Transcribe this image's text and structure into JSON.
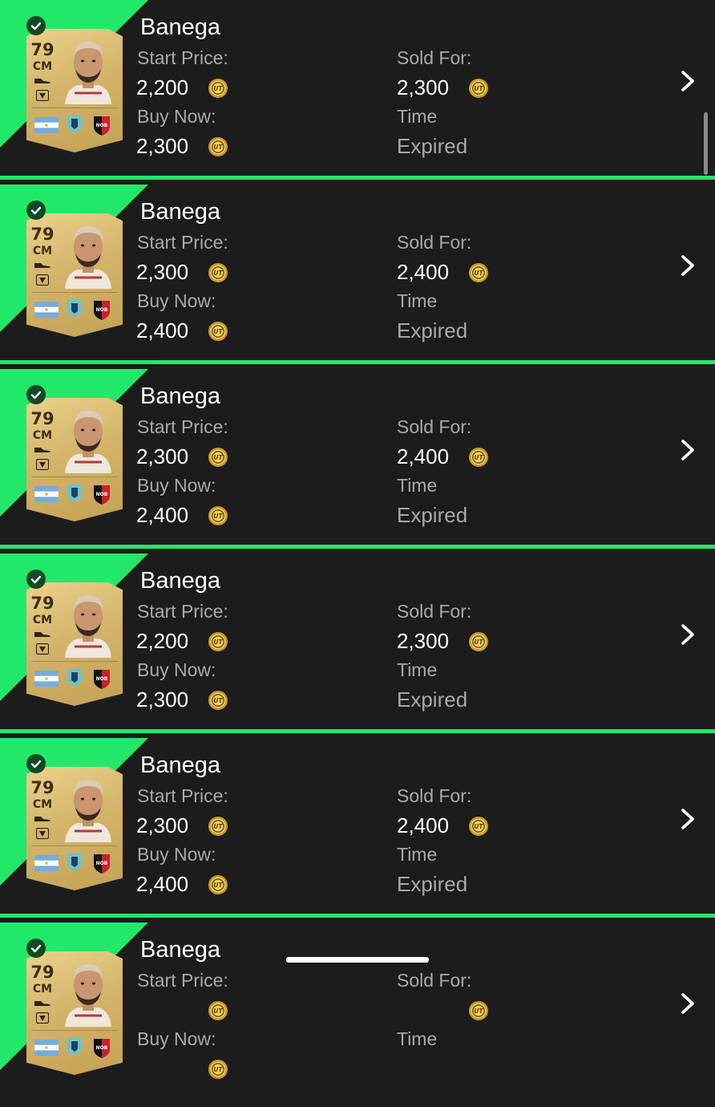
{
  "colors": {
    "sold_accent": "#22e86a",
    "background": "#1c1c1c",
    "label_gray": "#a9a9a9",
    "text_white": "#ffffff",
    "card_gold": "#d3b46a"
  },
  "labels": {
    "start_price": "Start Price:",
    "buy_now": "Buy Now:",
    "sold_for": "Sold For:",
    "time": "Time"
  },
  "icons": {
    "sold": "check-icon",
    "currency": "coin-icon",
    "open": "chevron-right-icon"
  },
  "items": [
    {
      "player": {
        "name": "Banega",
        "rating": "79",
        "position": "CM"
      },
      "start_price": "2,200",
      "buy_now": "2,300",
      "sold_for": "2,300",
      "time": "Expired"
    },
    {
      "player": {
        "name": "Banega",
        "rating": "79",
        "position": "CM"
      },
      "start_price": "2,300",
      "buy_now": "2,400",
      "sold_for": "2,400",
      "time": "Expired"
    },
    {
      "player": {
        "name": "Banega",
        "rating": "79",
        "position": "CM"
      },
      "start_price": "2,300",
      "buy_now": "2,400",
      "sold_for": "2,400",
      "time": "Expired"
    },
    {
      "player": {
        "name": "Banega",
        "rating": "79",
        "position": "CM"
      },
      "start_price": "2,200",
      "buy_now": "2,300",
      "sold_for": "2,300",
      "time": "Expired"
    },
    {
      "player": {
        "name": "Banega",
        "rating": "79",
        "position": "CM"
      },
      "start_price": "2,300",
      "buy_now": "2,400",
      "sold_for": "2,400",
      "time": "Expired"
    },
    {
      "player": {
        "name": "Banega",
        "rating": "79",
        "position": "CM"
      },
      "start_price": "",
      "buy_now": "",
      "sold_for": "",
      "time": ""
    }
  ]
}
